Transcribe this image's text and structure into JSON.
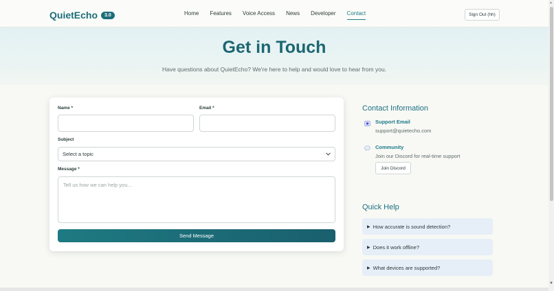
{
  "header": {
    "brand": "QuietEcho",
    "version_badge": "3.0",
    "nav": [
      "Home",
      "Features",
      "Voice Access",
      "News",
      "Developer",
      "Contact"
    ],
    "active_nav": "Contact",
    "signout": "Sign Out (hh)"
  },
  "hero": {
    "title": "Get in Touch",
    "subtitle": "Have questions about QuietEcho? We're here to help and would love to hear from you."
  },
  "form": {
    "name_label": "Name *",
    "name_value": "",
    "email_label": "Email *",
    "email_value": "",
    "subject_label": "Subject",
    "subject_selected": "Select a topic",
    "message_label": "Message *",
    "message_placeholder": "Tell us how we can help you...",
    "submit": "Send Message"
  },
  "contact": {
    "heading": "Contact Information",
    "support_title": "Support Email",
    "support_email": "support@quietecho.com",
    "community_title": "Community",
    "community_text": "Join our Discord for real-time support",
    "discord_button": "Join Discord"
  },
  "quick_help": {
    "heading": "Quick Help",
    "items": [
      "How accurate is sound detection?",
      "Does it work offline?",
      "What devices are supported?"
    ]
  },
  "colors": {
    "accent": "#1d6d7a",
    "hero_bg": "#e3f1f3",
    "faq_bg": "#e6eef7"
  },
  "icons": {
    "support": "envelope-icon",
    "community": "chat-bubble-icon",
    "select": "chevron-down-icon"
  }
}
